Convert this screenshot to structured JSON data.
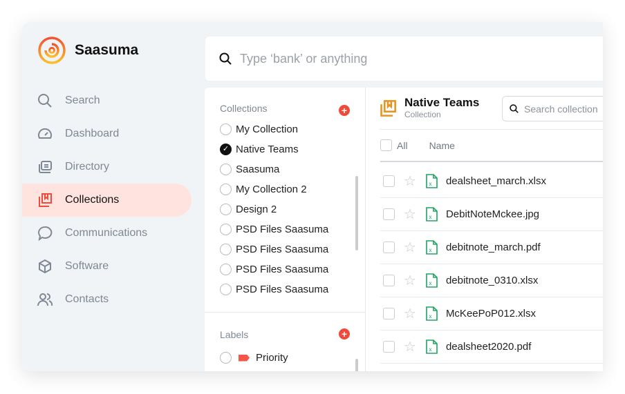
{
  "brand": {
    "name": "Saasuma"
  },
  "sidebar": {
    "items": [
      {
        "label": "Search",
        "icon": "search-icon"
      },
      {
        "label": "Dashboard",
        "icon": "gauge-icon"
      },
      {
        "label": "Directory",
        "icon": "directory-icon"
      },
      {
        "label": "Collections",
        "icon": "collections-icon",
        "active": true
      },
      {
        "label": "Communications",
        "icon": "chat-icon"
      },
      {
        "label": "Software",
        "icon": "box-icon"
      },
      {
        "label": "Contacts",
        "icon": "users-icon"
      }
    ]
  },
  "search": {
    "placeholder": "Type ‘bank’ or anything"
  },
  "collections": {
    "title": "Collections",
    "items": [
      {
        "label": "My Collection",
        "selected": false
      },
      {
        "label": "Native Teams",
        "selected": true
      },
      {
        "label": "Saasuma",
        "selected": false
      },
      {
        "label": "My Collection 2",
        "selected": false
      },
      {
        "label": "Design 2",
        "selected": false
      },
      {
        "label": "PSD Files Saasuma",
        "selected": false
      },
      {
        "label": "PSD Files Saasuma",
        "selected": false
      },
      {
        "label": "PSD Files Saasuma",
        "selected": false
      },
      {
        "label": "PSD Files Saasuma",
        "selected": false
      }
    ]
  },
  "labels": {
    "title": "Labels",
    "items": [
      {
        "label": "Priority",
        "color": "#f4574a"
      }
    ]
  },
  "main": {
    "title": "Native Teams",
    "subtitle": "Collection",
    "search_placeholder": "Search collection",
    "columns": {
      "all": "All",
      "name": "Name"
    },
    "files": [
      "dealsheet_march.xlsx",
      "DebitNoteMckee.jpg",
      "debitnote_march.pdf",
      "debitnote_0310.xlsx",
      "McKeePoP012.xlsx",
      "dealsheet2020.pdf"
    ]
  },
  "colors": {
    "accent": "#f04a3a",
    "active_bg": "#ffe3df",
    "collection_icon": "#e8951f",
    "file_icon": "#1fa463"
  }
}
